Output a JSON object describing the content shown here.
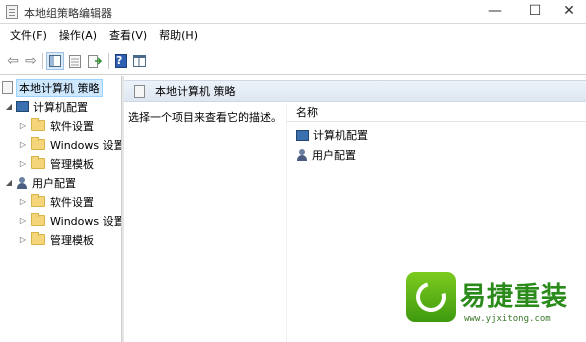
{
  "window": {
    "title": "本地组策略编辑器",
    "min_glyph": "—",
    "max_glyph": "☐",
    "close_glyph": "✕"
  },
  "menu": [
    "文件(F)",
    "操作(A)",
    "查看(V)",
    "帮助(H)"
  ],
  "toolbar": {
    "buttons": [
      "back-arrow-icon",
      "forward-arrow-icon",
      "show-hide-tree-icon",
      "properties-icon",
      "export-list-icon",
      "help-icon",
      "extended-view-icon"
    ],
    "back": "⇦",
    "forward": "⇨",
    "help": "?"
  },
  "tree": {
    "root": "本地计算机 策略",
    "computer_config": "计算机配置",
    "user_config": "用户配置",
    "software_settings": "软件设置",
    "windows_settings": "Windows 设置",
    "admin_templates": "管理模板",
    "expanded_glyph": "◢",
    "collapsed_glyph": "▷"
  },
  "details": {
    "header": "本地计算机 策略",
    "description": "选择一个项目来查看它的描述。",
    "column_name": "名称",
    "items": [
      "计算机配置",
      "用户配置"
    ]
  },
  "watermark": {
    "brand": "易捷重装",
    "url": "www.yjxitong.com"
  }
}
